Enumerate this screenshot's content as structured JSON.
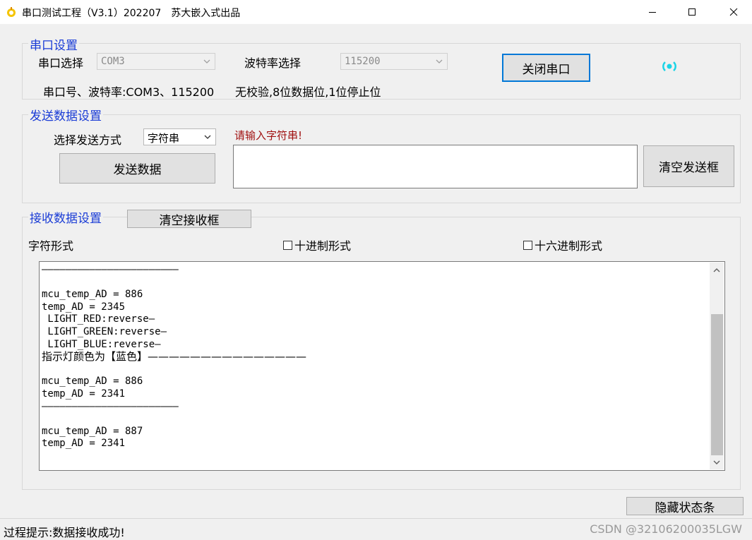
{
  "window": {
    "title": "串口测试工程（V3.1）202207　苏大嵌入式出品",
    "minimize_glyph": "—",
    "close_glyph": "✕"
  },
  "serial_settings": {
    "group_title": "串口设置",
    "port_label": "串口选择",
    "port_value": "COM3",
    "baud_label": "波特率选择",
    "baud_value": "115200",
    "close_button": "关闭串口",
    "info_port_baud": "串口号、波特率:COM3、115200",
    "info_format": "无校验,8位数据位,1位停止位",
    "status_color": "#1ad4e6"
  },
  "send_settings": {
    "group_title": "发送数据设置",
    "mode_label": "选择发送方式",
    "mode_value": "字符串",
    "send_button": "发送数据",
    "input_hint": "请输入字符串!",
    "input_value": "",
    "clear_button": "清空发送框",
    "hint_color": "#a01010"
  },
  "receive_settings": {
    "group_title": "接收数据设置",
    "clear_button": "清空接收框",
    "char_format_label": "字符形式",
    "decimal_option": "十进制形式",
    "hex_option": "十六进制形式",
    "lines": [
      "———————————————————————",
      "",
      "mcu_temp_AD = 886",
      "temp_AD = 2345",
      " LIGHT_RED:reverse—",
      " LIGHT_GREEN:reverse—",
      " LIGHT_BLUE:reverse—",
      "指示灯颜色为【蓝色】———————————————",
      "",
      "mcu_temp_AD = 886",
      "temp_AD = 2341",
      "———————————————————————",
      "",
      "mcu_temp_AD = 887",
      "temp_AD = 2341"
    ]
  },
  "footer": {
    "hide_status_button": "隐藏状态条",
    "status_text": "过程提示:数据接收成功!",
    "watermark": "CSDN @32106200035LGW"
  },
  "accent_color": "#1a3cd6"
}
